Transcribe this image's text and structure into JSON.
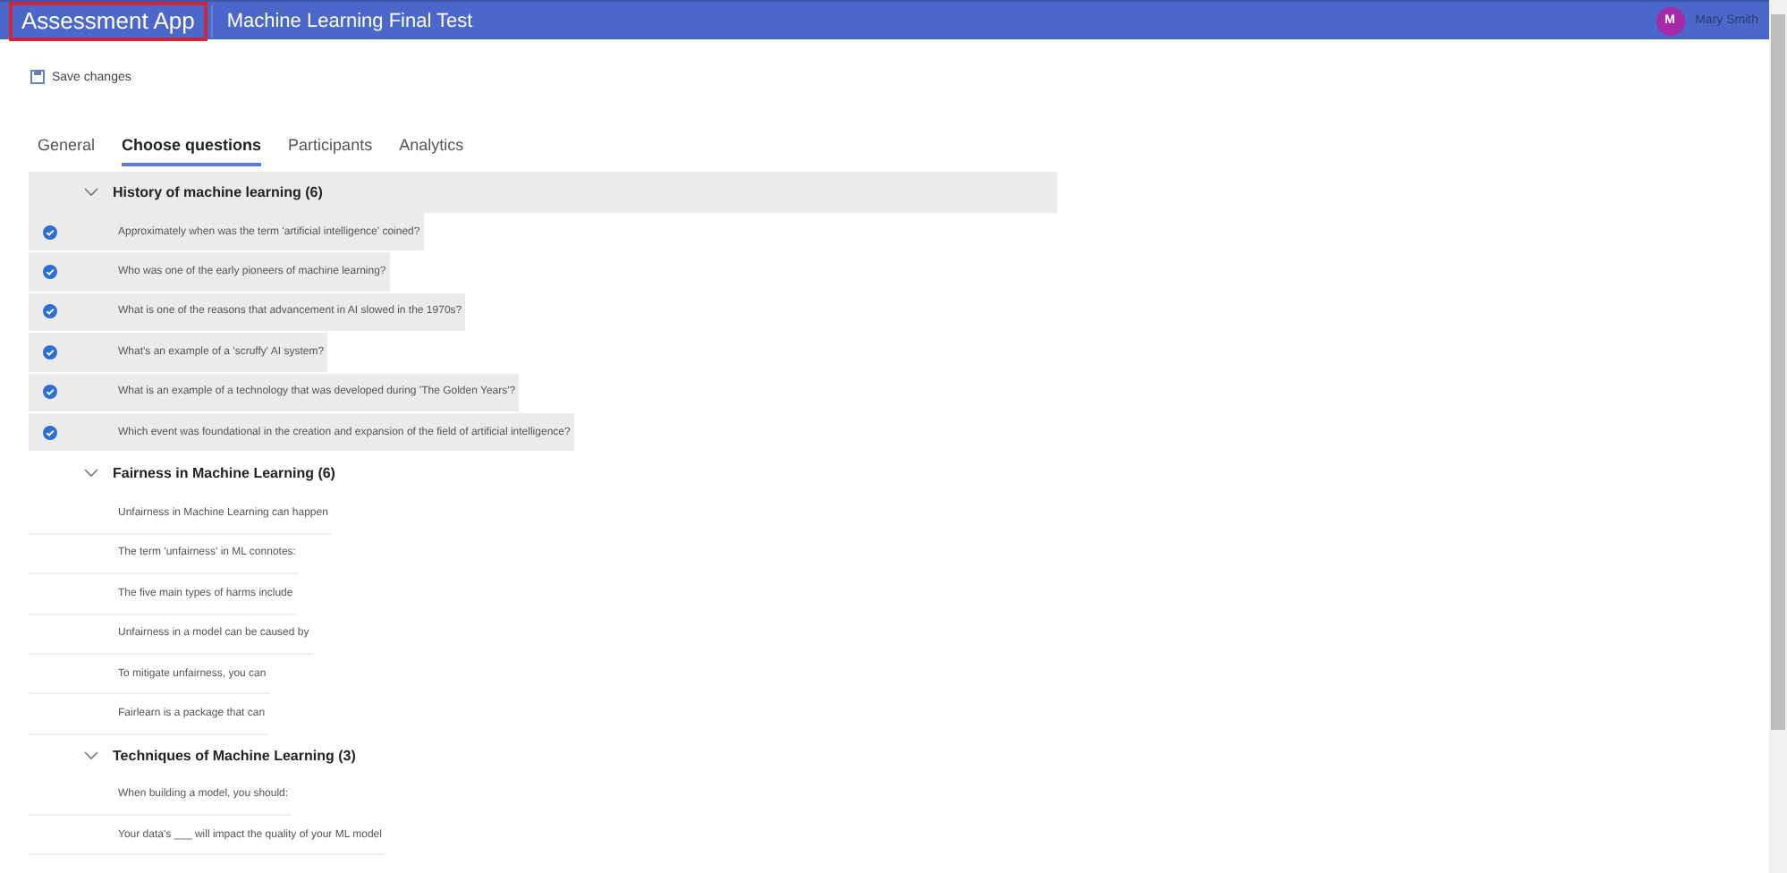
{
  "header": {
    "app_name": "Assessment App",
    "test_title": "Machine Learning Final Test",
    "user": {
      "initial": "M",
      "name": "Mary Smith"
    }
  },
  "toolbar": {
    "save_label": "Save changes"
  },
  "tabs": [
    {
      "label": "General",
      "selected": false
    },
    {
      "label": "Choose questions",
      "selected": true
    },
    {
      "label": "Participants",
      "selected": false
    },
    {
      "label": "Analytics",
      "selected": false
    }
  ],
  "groups": [
    {
      "title": "History of machine learning (6)",
      "expanded": true,
      "selected": true,
      "questions": [
        {
          "text": "Approximately when was the term 'artificial intelligence' coined?",
          "selected": true
        },
        {
          "text": "Who was one of the early pioneers of machine learning?",
          "selected": true
        },
        {
          "text": "What is one of the reasons that advancement in AI slowed in the 1970s?",
          "selected": true
        },
        {
          "text": "What's an example of a 'scruffy' AI system?",
          "selected": true
        },
        {
          "text": "What is an example of a technology that was developed during 'The Golden Years'?",
          "selected": true
        },
        {
          "text": "Which event was foundational in the creation and expansion of the field of artificial intelligence?",
          "selected": true
        }
      ]
    },
    {
      "title": "Fairness in Machine Learning (6)",
      "expanded": true,
      "selected": false,
      "questions": [
        {
          "text": "Unfairness in Machine Learning can happen",
          "selected": false
        },
        {
          "text": "The term 'unfairness' in ML connotes:",
          "selected": false
        },
        {
          "text": "The five main types of harms include",
          "selected": false
        },
        {
          "text": "Unfairness in a model can be caused by",
          "selected": false
        },
        {
          "text": "To mitigate unfairness, you can",
          "selected": false
        },
        {
          "text": "Fairlearn is a package that can",
          "selected": false
        }
      ]
    },
    {
      "title": "Techniques of Machine Learning (3)",
      "expanded": true,
      "selected": false,
      "questions": [
        {
          "text": "When building a model, you should:",
          "selected": false
        },
        {
          "text": "Your data's ___ will impact the quality of your ML model",
          "selected": false
        }
      ]
    }
  ]
}
